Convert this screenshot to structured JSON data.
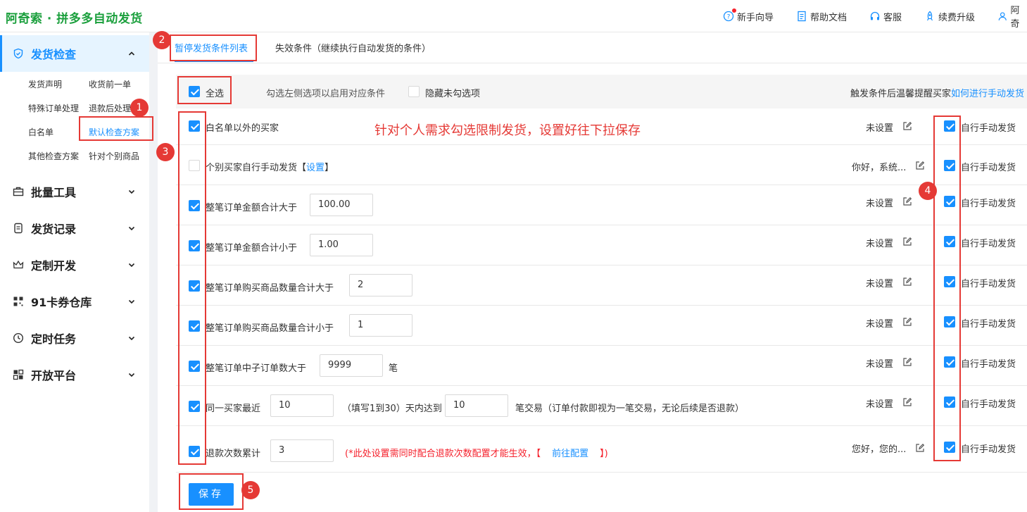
{
  "app": {
    "title": "阿奇索 · 拼多多自动发货"
  },
  "topnav": [
    "新手向导",
    "帮助文档",
    "客服",
    "续费升级",
    "阿奇"
  ],
  "sidebar": {
    "groups": [
      {
        "label": "发货检查",
        "icon": "shield-icon",
        "expanded": true,
        "items": [
          "发货声明",
          "收货前一单",
          "特殊订单处理",
          "退款后处理",
          "白名单",
          "默认检查方案",
          "其他检查方案",
          "针对个别商品"
        ]
      },
      {
        "label": "批量工具",
        "icon": "briefcase-icon"
      },
      {
        "label": "发货记录",
        "icon": "receipt-icon"
      },
      {
        "label": "定制开发",
        "icon": "crown-icon"
      },
      {
        "label": "91卡券仓库",
        "icon": "qr-icon"
      },
      {
        "label": "定时任务",
        "icon": "clock-icon"
      },
      {
        "label": "开放平台",
        "icon": "grid-icon"
      }
    ],
    "active_item": "默认检查方案"
  },
  "tabs": [
    "暂停发货条件列表",
    "失效条件（继续执行自动发货的条件）"
  ],
  "toolbar": {
    "select_all": "全选",
    "hint": "勾选左侧选项以启用对应条件",
    "hide_unchecked": "隐藏未勾选项",
    "right_text": "触发条件后温馨提醒买家",
    "right_link": "如何进行手动发货"
  },
  "annotation_text": "针对个人需求勾选限制发货，设置好往下拉保存",
  "badges": [
    "1",
    "2",
    "3",
    "4",
    "5"
  ],
  "right_check_label": "自行手动发货",
  "rows": [
    {
      "label": "白名单以外的买家",
      "checked": true,
      "status": "未设置",
      "manual": true
    },
    {
      "label": "个别买家自行手动发货",
      "link": "设置",
      "checked": false,
      "status": "你好，系统...",
      "manual": true
    },
    {
      "label": "整笔订单金额合计大于",
      "value": "100.00",
      "checked": true,
      "status": "未设置",
      "manual": true
    },
    {
      "label": "整笔订单金额合计小于",
      "value": "1.00",
      "checked": true,
      "status": "未设置",
      "manual": true
    },
    {
      "label": "整笔订单购买商品数量合计大于",
      "value": "2",
      "checked": true,
      "status": "未设置",
      "manual": true
    },
    {
      "label": "整笔订单购买商品数量合计小于",
      "value": "1",
      "checked": true,
      "status": "未设置",
      "manual": true
    },
    {
      "label": "整笔订单中子订单数大于",
      "value": "9999",
      "suffix": "笔",
      "checked": true,
      "status": "未设置",
      "manual": true
    },
    {
      "label": "同一买家最近",
      "value": "10",
      "mid": "（填写1到30）天内达到",
      "value2": "10",
      "suffix": "笔交易（订单付款即视为一笔交易，无论后续是否退款）",
      "checked": true,
      "status": "未设置",
      "manual": true
    },
    {
      "label": "退款次数累计",
      "value": "3",
      "warn": "(*此处设置需同时配合退款次数配置才能生效，【",
      "warn_link": "前往配置",
      "warn_end": "】)",
      "checked": true,
      "status": "您好，您的...",
      "manual": true
    }
  ],
  "save_label": "保存"
}
